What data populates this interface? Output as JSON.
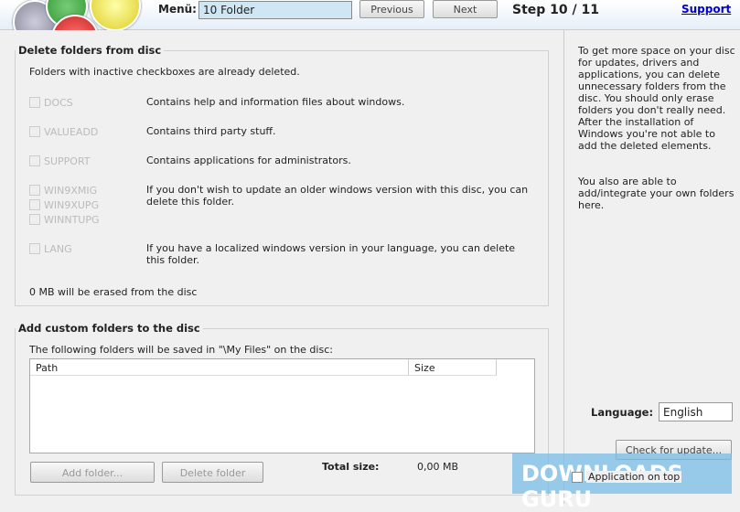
{
  "header": {
    "menu_label": "Menü:",
    "menu_value": "10 Folder",
    "previous": "Previous",
    "next": "Next",
    "step": "Step 10 / 11",
    "support": "Support"
  },
  "delete": {
    "title": "Delete folders from disc",
    "note": "Folders with inactive checkboxes are already deleted.",
    "items": [
      {
        "names": [
          "DOCS"
        ],
        "desc": "Contains help and information files about windows."
      },
      {
        "names": [
          "VALUEADD"
        ],
        "desc": "Contains third party stuff."
      },
      {
        "names": [
          "SUPPORT"
        ],
        "desc": "Contains applications for administrators."
      },
      {
        "names": [
          "WIN9XMIG",
          "WIN9XUPG",
          "WINNTUPG"
        ],
        "desc": "If you don't wish to update an older windows version with this disc, you can delete this folder."
      },
      {
        "names": [
          "LANG"
        ],
        "desc": "If you have a localized windows version in your language, you can delete this folder."
      }
    ],
    "summary": "0 MB will be erased from the disc"
  },
  "custom": {
    "title": "Add custom folders to the disc",
    "note": "The following folders will be saved in \"\\My Files\" on the disc:",
    "col_path": "Path",
    "col_size": "Size",
    "add": "Add folder...",
    "delete": "Delete folder",
    "total_label": "Total size:",
    "total_value": "0,00 MB"
  },
  "side": {
    "text1": "To get more space on your disc for updates, drivers and applications, you can delete unnecessary folders from the disc. You should only erase folders you don't really need. After the installation of Windows you're not able to add the deleted elements.",
    "text2": "You also are able to add/integrate your own folders here.",
    "language_label": "Language:",
    "language_value": "English",
    "check_update": "Check for update...",
    "on_top": "Application on top"
  },
  "watermark": "DOWNLOADS GURU"
}
